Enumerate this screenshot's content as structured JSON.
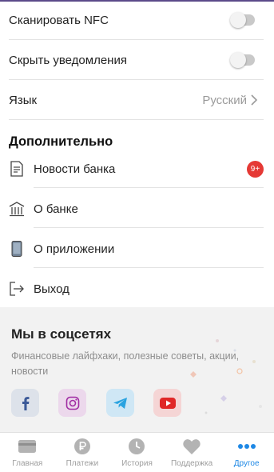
{
  "settings": {
    "nfc_label": "Сканировать NFC",
    "hide_notifications_label": "Скрыть уведомления",
    "language_label": "Язык",
    "language_value": "Русский"
  },
  "additional": {
    "title": "Дополнительно",
    "items": [
      {
        "label": "Новости банка",
        "icon": "document-icon",
        "badge": "9+"
      },
      {
        "label": "О банке",
        "icon": "bank-building-icon"
      },
      {
        "label": "О приложении",
        "icon": "smartphone-icon"
      },
      {
        "label": "Выход",
        "icon": "logout-icon"
      }
    ]
  },
  "social": {
    "title": "Мы в соцсетях",
    "description": "Финансовые лайфхаки, полезные советы, акции, новости",
    "networks": [
      {
        "name": "facebook-icon",
        "color": "#3b5998",
        "bg": "#dde2ea"
      },
      {
        "name": "instagram-icon",
        "color": "#a02ca3",
        "bg": "#ecd8ec"
      },
      {
        "name": "telegram-icon",
        "color": "#2aa3e0",
        "bg": "#cfe7f5"
      },
      {
        "name": "youtube-icon",
        "color": "#e02828",
        "bg": "#f5d5d5"
      }
    ]
  },
  "tabbar": {
    "tabs": [
      {
        "label": "Главная",
        "icon": "card-icon",
        "active": false
      },
      {
        "label": "Платежи",
        "icon": "ruble-coin-icon",
        "active": false
      },
      {
        "label": "История",
        "icon": "clock-icon",
        "active": false
      },
      {
        "label": "Поддержка",
        "icon": "heart-icon",
        "active": false
      },
      {
        "label": "Другое",
        "icon": "more-dots-icon",
        "active": true
      }
    ]
  },
  "colors": {
    "accent": "#1e88e5",
    "badge": "#e53935",
    "inactive": "#9e9e9e"
  }
}
